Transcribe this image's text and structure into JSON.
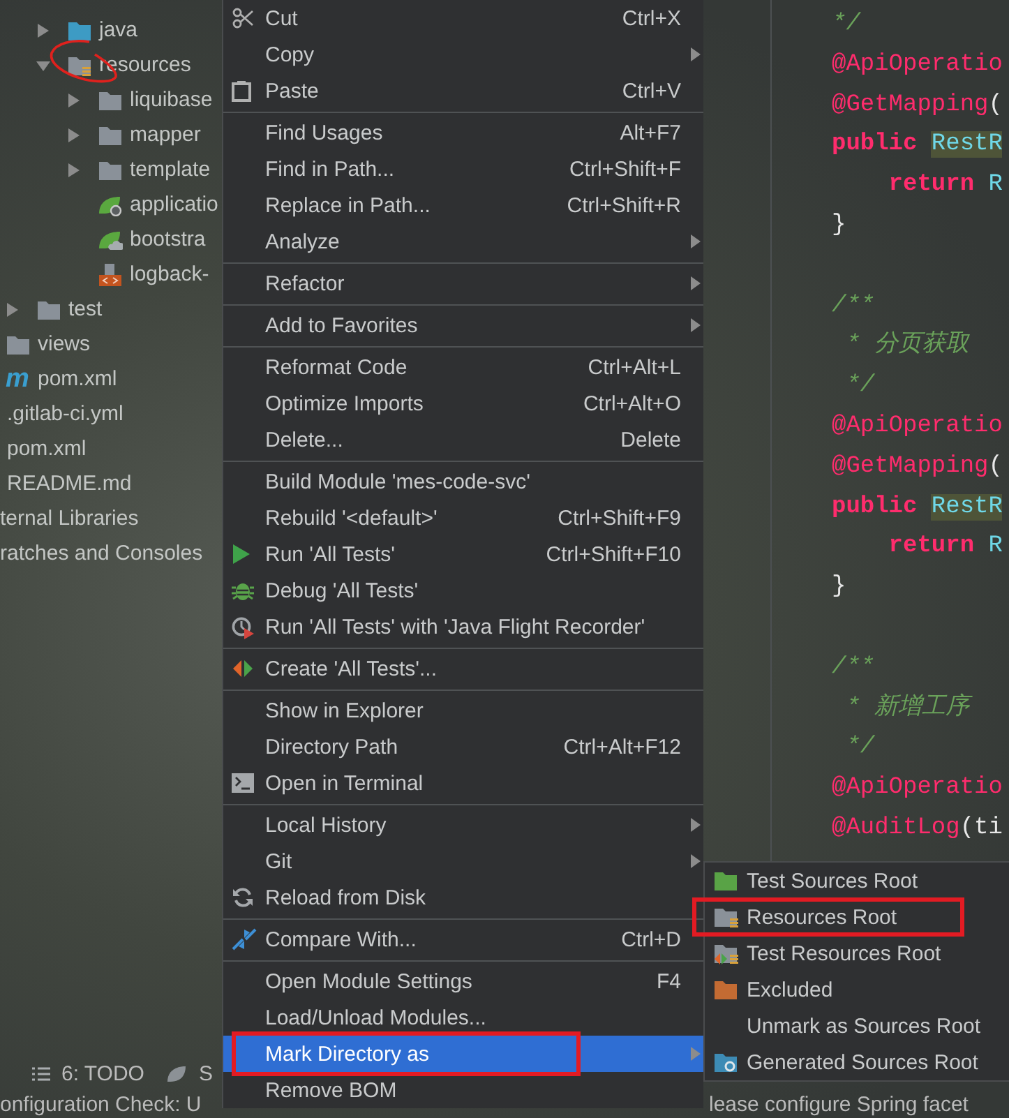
{
  "project_tree": [
    {
      "children": [
        {
          "children": [
            {
              "children": [
                {
                  "children": [
                    {
                      "label": "java",
                      "kind": "source-folder",
                      "expanded": false,
                      "annotated": false
                    },
                    {
                      "label": "resources",
                      "kind": "resources-folder",
                      "expanded": true,
                      "annotated": true,
                      "children": [
                        {
                          "label": "liquibase",
                          "kind": "folder",
                          "expanded": false,
                          "annotated": false
                        },
                        {
                          "label": "mapper",
                          "kind": "folder",
                          "expanded": false,
                          "annotated": false
                        },
                        {
                          "label": "template",
                          "kind": "folder",
                          "expanded": false,
                          "annotated": false
                        },
                        {
                          "label": "applicatio",
                          "kind": "spring-config",
                          "annotated": false
                        },
                        {
                          "label": "bootstra",
                          "kind": "spring-bootstrap",
                          "annotated": false
                        },
                        {
                          "label": "logback-",
                          "kind": "xml-file",
                          "annotated": false
                        }
                      ]
                    }
                  ]
                },
                {
                  "label": "test",
                  "kind": "folder",
                  "expanded": false,
                  "annotated": false
                }
              ]
            },
            {
              "label": "views",
              "kind": "folder",
              "annotated": false
            },
            {
              "label": "pom.xml",
              "kind": "maven",
              "badge": "m",
              "annotated": false
            }
          ]
        },
        {
          "label": ".gitlab-ci.yml",
          "annotated": false
        },
        {
          "label": "pom.xml",
          "annotated": false
        },
        {
          "label": "README.md",
          "annotated": false
        }
      ]
    },
    {
      "label": "ternal Libraries",
      "annotated": false
    },
    {
      "label": "ratches and Consoles",
      "annotated": false
    }
  ],
  "editor": {
    "blocks": [
      {
        "lines": [
          {
            "tokens": [
              {
                "text": "*/",
                "kind": "comment"
              }
            ]
          },
          {
            "tokens": [
              {
                "text": "@ApiOperatio",
                "kind": "annotation"
              }
            ]
          },
          {
            "tokens": [
              {
                "text": "@GetMapping",
                "kind": "annotation"
              },
              {
                "text": "(",
                "kind": "plain"
              }
            ]
          },
          {
            "tokens": [
              {
                "text": "public ",
                "kind": "keyword"
              },
              {
                "text": "RestR",
                "kind": "type",
                "highlighted": true
              }
            ]
          },
          {
            "tokens": [
              {
                "text": "    return ",
                "kind": "keyword"
              },
              {
                "text": "R",
                "kind": "type",
                "highlighted": false
              }
            ]
          },
          {
            "tokens": [
              {
                "text": "}",
                "kind": "plain"
              }
            ]
          }
        ]
      },
      {
        "lines": [
          {
            "tokens": [
              {
                "text": "/**",
                "kind": "comment"
              }
            ]
          },
          {
            "tokens": [
              {
                "text": " * 分页获取",
                "kind": "comment"
              }
            ]
          },
          {
            "tokens": [
              {
                "text": " */",
                "kind": "comment"
              }
            ]
          },
          {
            "tokens": [
              {
                "text": "@ApiOperatio",
                "kind": "annotation"
              }
            ]
          },
          {
            "tokens": [
              {
                "text": "@GetMapping",
                "kind": "annotation"
              },
              {
                "text": "(",
                "kind": "plain"
              }
            ]
          },
          {
            "tokens": [
              {
                "text": "public ",
                "kind": "keyword"
              },
              {
                "text": "RestR",
                "kind": "type",
                "highlighted": true
              }
            ]
          },
          {
            "tokens": [
              {
                "text": "    return ",
                "kind": "keyword"
              },
              {
                "text": "R",
                "kind": "type",
                "highlighted": false
              }
            ]
          },
          {
            "tokens": [
              {
                "text": "}",
                "kind": "plain"
              }
            ]
          }
        ]
      },
      {
        "lines": [
          {
            "tokens": [
              {
                "text": "/**",
                "kind": "comment"
              }
            ]
          },
          {
            "tokens": [
              {
                "text": " * 新增工序",
                "kind": "comment"
              }
            ]
          },
          {
            "tokens": [
              {
                "text": " */",
                "kind": "comment"
              }
            ]
          },
          {
            "tokens": [
              {
                "text": "@ApiOperatio",
                "kind": "annotation"
              }
            ]
          },
          {
            "tokens": [
              {
                "text": "@AuditLog",
                "kind": "annotation"
              },
              {
                "text": "(ti",
                "kind": "plain"
              }
            ]
          }
        ]
      }
    ]
  },
  "context_menu": {
    "items": [
      {
        "kind": "scissors",
        "label": "Cut",
        "shortcut": "Ctrl+X",
        "submenu": false,
        "selected": false,
        "annotated": false
      },
      {
        "kind": "plain",
        "label": "Copy",
        "submenu": true,
        "selected": false,
        "annotated": false
      },
      {
        "kind": "clipboard",
        "label": "Paste",
        "shortcut": "Ctrl+V",
        "submenu": false,
        "selected": false,
        "annotated": false
      },
      {
        "kind": "separator"
      },
      {
        "kind": "plain",
        "label": "Find Usages",
        "shortcut": "Alt+F7",
        "submenu": false,
        "selected": false,
        "annotated": false
      },
      {
        "kind": "plain",
        "label": "Find in Path...",
        "shortcut": "Ctrl+Shift+F",
        "submenu": false,
        "selected": false,
        "annotated": false
      },
      {
        "kind": "plain",
        "label": "Replace in Path...",
        "shortcut": "Ctrl+Shift+R",
        "submenu": false,
        "selected": false,
        "annotated": false
      },
      {
        "kind": "plain",
        "label": "Analyze",
        "submenu": true,
        "selected": false,
        "annotated": false
      },
      {
        "kind": "separator"
      },
      {
        "kind": "plain",
        "label": "Refactor",
        "submenu": true,
        "selected": false,
        "annotated": false
      },
      {
        "kind": "separator"
      },
      {
        "kind": "plain",
        "label": "Add to Favorites",
        "submenu": true,
        "selected": false,
        "annotated": false
      },
      {
        "kind": "separator"
      },
      {
        "kind": "plain",
        "label": "Reformat Code",
        "shortcut": "Ctrl+Alt+L",
        "submenu": false,
        "selected": false,
        "annotated": false
      },
      {
        "kind": "plain",
        "label": "Optimize Imports",
        "shortcut": "Ctrl+Alt+O",
        "submenu": false,
        "selected": false,
        "annotated": false
      },
      {
        "kind": "plain",
        "label": "Delete...",
        "shortcut": "Delete",
        "submenu": false,
        "selected": false,
        "annotated": false
      },
      {
        "kind": "separator"
      },
      {
        "kind": "plain",
        "label": "Build Module 'mes-code-svc'",
        "submenu": false,
        "selected": false,
        "annotated": false
      },
      {
        "kind": "plain",
        "label": "Rebuild '<default>'",
        "shortcut": "Ctrl+Shift+F9",
        "submenu": false,
        "selected": false,
        "annotated": false
      },
      {
        "kind": "run",
        "label": "Run 'All Tests'",
        "shortcut": "Ctrl+Shift+F10",
        "submenu": false,
        "selected": false,
        "annotated": false
      },
      {
        "kind": "debug",
        "label": "Debug 'All Tests'",
        "submenu": false,
        "selected": false,
        "annotated": false
      },
      {
        "kind": "profiler",
        "label": "Run 'All Tests' with 'Java Flight Recorder'",
        "submenu": false,
        "selected": false,
        "annotated": false
      },
      {
        "kind": "separator"
      },
      {
        "kind": "create-test",
        "label": "Create 'All Tests'...",
        "submenu": false,
        "selected": false,
        "annotated": false
      },
      {
        "kind": "separator"
      },
      {
        "kind": "plain",
        "label": "Show in Explorer",
        "submenu": false,
        "selected": false,
        "annotated": false
      },
      {
        "kind": "plain",
        "label": "Directory Path",
        "shortcut": "Ctrl+Alt+F12",
        "submenu": false,
        "selected": false,
        "annotated": false
      },
      {
        "kind": "terminal",
        "label": "Open in Terminal",
        "submenu": false,
        "selected": false,
        "annotated": false
      },
      {
        "kind": "separator"
      },
      {
        "kind": "plain",
        "label": "Local History",
        "submenu": true,
        "selected": false,
        "annotated": false
      },
      {
        "kind": "plain",
        "label": "Git",
        "submenu": true,
        "selected": false,
        "annotated": false
      },
      {
        "kind": "reload",
        "label": "Reload from Disk",
        "submenu": false,
        "selected": false,
        "annotated": false
      },
      {
        "kind": "separator"
      },
      {
        "kind": "compare",
        "label": "Compare With...",
        "shortcut": "Ctrl+D",
        "submenu": false,
        "selected": false,
        "annotated": false
      },
      {
        "kind": "separator"
      },
      {
        "kind": "plain",
        "label": "Open Module Settings",
        "shortcut": "F4",
        "submenu": false,
        "selected": false,
        "annotated": false
      },
      {
        "kind": "plain",
        "label": "Load/Unload Modules...",
        "submenu": false,
        "selected": false,
        "annotated": false
      },
      {
        "kind": "plain",
        "label": "Mark Directory as",
        "submenu": true,
        "selected": true,
        "annotated": true
      },
      {
        "kind": "plain",
        "label": "Remove BOM",
        "submenu": false,
        "selected": false,
        "annotated": false
      }
    ]
  },
  "submenu": {
    "items": [
      {
        "kind": "test-sources-folder",
        "label": "Test Sources Root",
        "selected": false,
        "annotated": false
      },
      {
        "kind": "resources-folder",
        "label": "Resources Root",
        "selected": false,
        "annotated": true
      },
      {
        "kind": "test-resources-folder",
        "label": "Test Resources Root",
        "selected": false,
        "annotated": false
      },
      {
        "kind": "excluded-folder",
        "label": "Excluded",
        "selected": false,
        "annotated": false
      },
      {
        "kind": "plain",
        "label": "Unmark as Sources Root",
        "selected": false,
        "annotated": false
      },
      {
        "kind": "generated-folder",
        "label": "Generated Sources Root",
        "selected": false,
        "annotated": false
      }
    ]
  },
  "tool_window_bar": {
    "buttons": [
      {
        "kind": "list",
        "label": "6: TODO"
      },
      {
        "kind": "leaf",
        "label": "S"
      }
    ]
  },
  "status_bar": {
    "left_text": "onfiguration Check: U",
    "right_text": "lease configure Spring facet"
  }
}
